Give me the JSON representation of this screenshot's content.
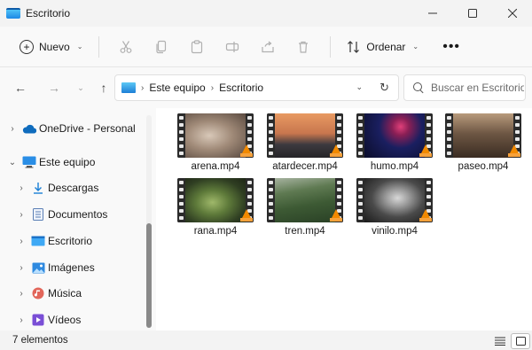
{
  "window": {
    "title": "Escritorio",
    "controls": [
      "minimize-icon",
      "maximize-icon",
      "close-icon"
    ]
  },
  "command_bar": {
    "new_label": "Nuevo",
    "sort_label": "Ordenar",
    "tools": [
      "cut-icon",
      "copy-icon",
      "paste-icon",
      "rename-icon",
      "share-icon",
      "delete-icon"
    ],
    "more": "•••"
  },
  "address_bar": {
    "breadcrumbs": [
      "Este equipo",
      "Escritorio"
    ],
    "search_placeholder": "Buscar en Escritorio"
  },
  "sidebar": {
    "items": [
      {
        "label": "OneDrive - Personal",
        "icon": "cloud-icon",
        "expanded": false,
        "level": 0
      },
      {
        "label": "Este equipo",
        "icon": "pc-icon",
        "expanded": true,
        "level": 0
      },
      {
        "label": "Descargas",
        "icon": "download-icon",
        "expanded": false,
        "level": 1
      },
      {
        "label": "Documentos",
        "icon": "documents-icon",
        "expanded": false,
        "level": 1
      },
      {
        "label": "Escritorio",
        "icon": "desktop-icon",
        "expanded": false,
        "level": 1
      },
      {
        "label": "Imágenes",
        "icon": "pictures-icon",
        "expanded": false,
        "level": 1
      },
      {
        "label": "Música",
        "icon": "music-icon",
        "expanded": false,
        "level": 1
      },
      {
        "label": "Vídeos",
        "icon": "videos-icon",
        "expanded": false,
        "level": 1
      }
    ]
  },
  "files": [
    {
      "name": "arena.mp4"
    },
    {
      "name": "atardecer.mp4"
    },
    {
      "name": "humo.mp4"
    },
    {
      "name": "paseo.mp4"
    },
    {
      "name": "rana.mp4"
    },
    {
      "name": "tren.mp4"
    },
    {
      "name": "vinilo.mp4"
    }
  ],
  "status_bar": {
    "count": "7 elementos"
  },
  "colors": {
    "accent": "#0067c0",
    "vlc_orange": "#f18900"
  }
}
